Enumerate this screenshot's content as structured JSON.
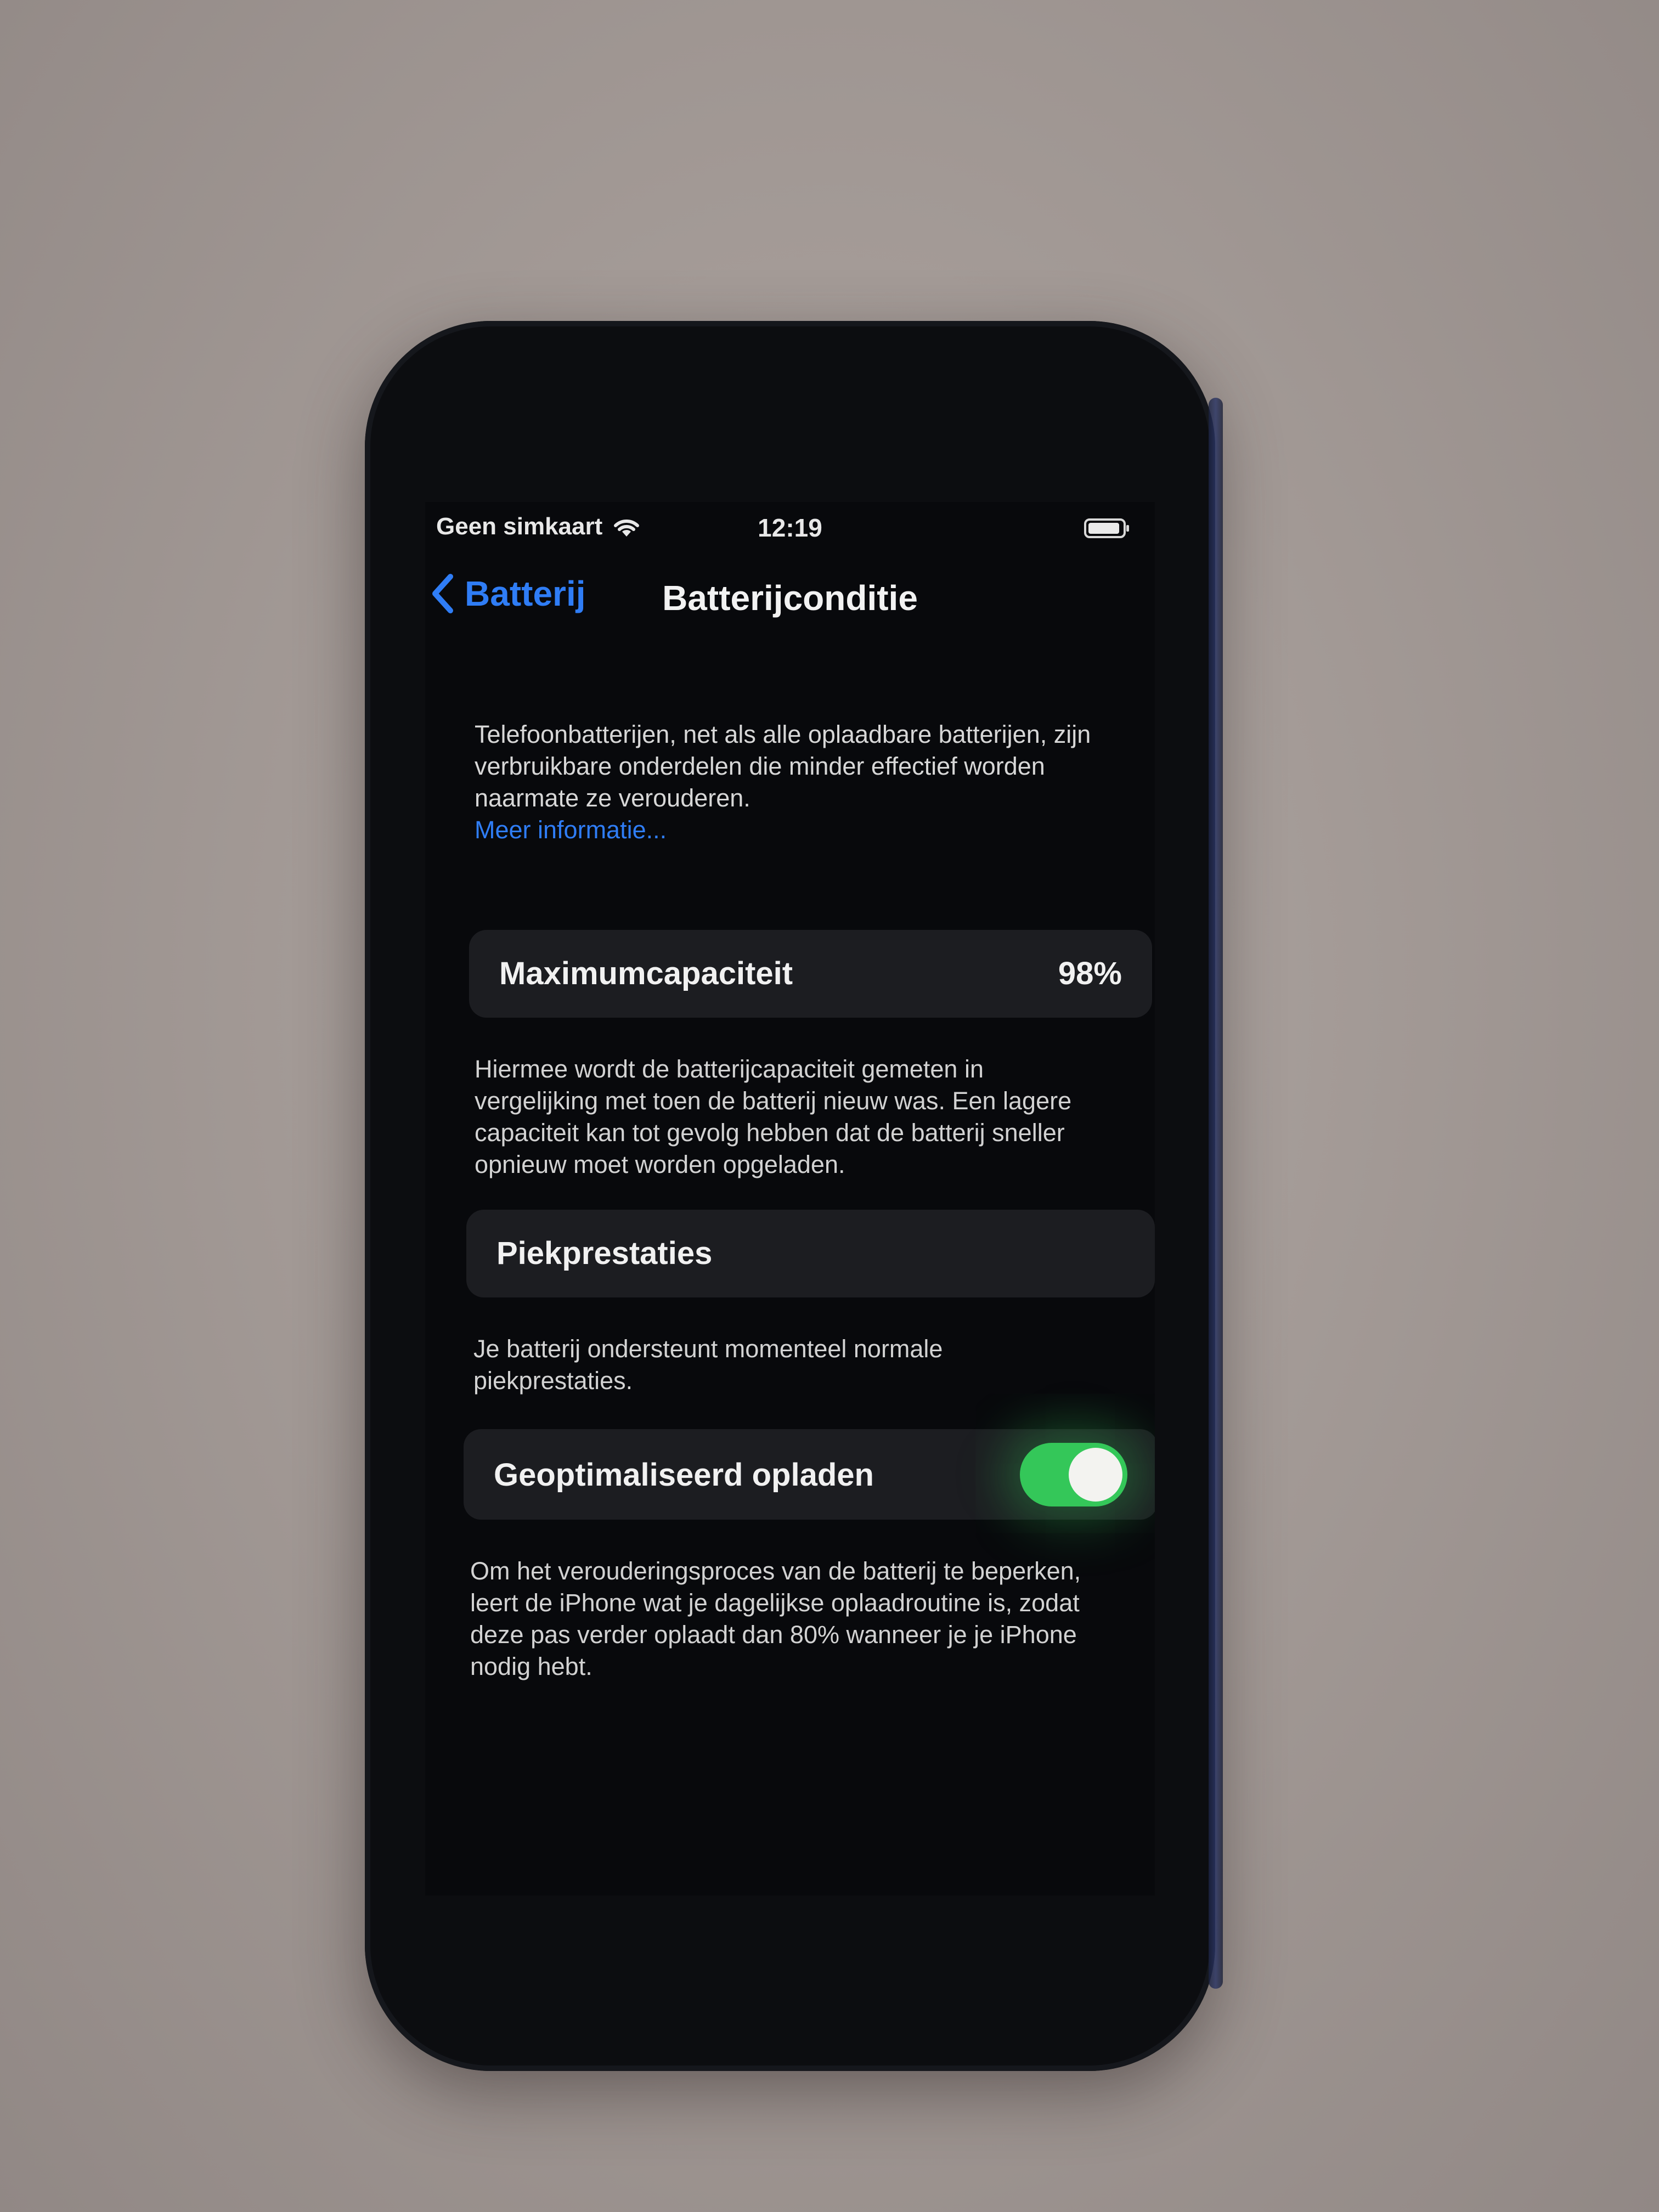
{
  "status_bar": {
    "carrier": "Geen simkaart",
    "time": "12:19",
    "wifi_icon": "wifi-icon",
    "battery_icon": "battery-icon"
  },
  "nav": {
    "back_label": "Batterij",
    "back_icon": "chevron-left-icon",
    "title": "Batterijconditie"
  },
  "intro": {
    "text": "Telefoonbatterijen, net als alle oplaadbare batterijen, zijn verbruikbare onderdelen die minder effectief worden naarmate ze verouderen.",
    "link": "Meer informatie..."
  },
  "max_capacity": {
    "label": "Maximumcapaciteit",
    "value": "98%",
    "footer": "Hiermee wordt de batterijcapaciteit gemeten in vergelijking met toen de batterij nieuw was. Een lagere capaciteit kan tot gevolg hebben dat de batterij sneller opnieuw moet worden opgeladen."
  },
  "peak_performance": {
    "label": "Piekprestaties",
    "footer": "Je batterij ondersteunt momenteel normale piekprestaties."
  },
  "optimized_charging": {
    "label": "Geoptimaliseerd opladen",
    "enabled": true,
    "footer": "Om het verouderingsproces van de batterij te beperken, leert de iPhone wat je dagelijkse oplaadroutine is, zodat deze pas verder oplaadt dan 80% wanneer je je iPhone nodig hebt."
  },
  "colors": {
    "accent": "#2f7df6",
    "toggle_on": "#34c759",
    "cell_background": "#1c1d21",
    "screen_background": "#08090c"
  }
}
